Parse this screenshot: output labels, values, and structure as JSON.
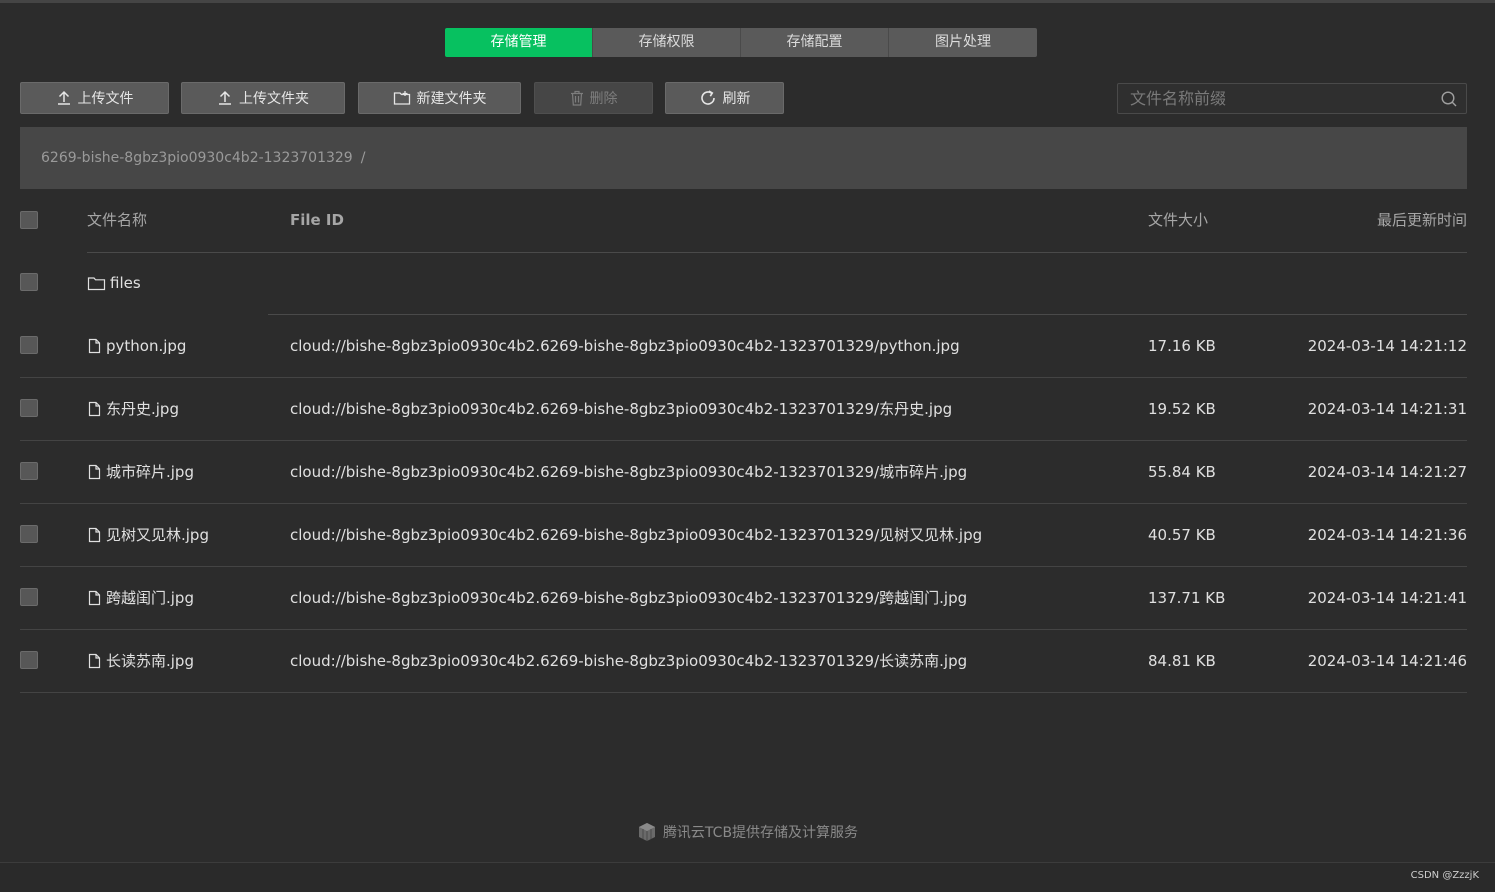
{
  "tabs": [
    {
      "label": "存储管理",
      "active": true
    },
    {
      "label": "存储权限",
      "active": false
    },
    {
      "label": "存储配置",
      "active": false
    },
    {
      "label": "图片处理",
      "active": false
    }
  ],
  "toolbar": {
    "upload_file": "上传文件",
    "upload_folder": "上传文件夹",
    "new_folder": "新建文件夹",
    "delete": "删除",
    "refresh": "刷新"
  },
  "search": {
    "placeholder": "文件名称前缀",
    "value": ""
  },
  "breadcrumb": {
    "bucket": "6269-bishe-8gbz3pio0930c4b2-1323701329",
    "separator": "/"
  },
  "table": {
    "headers": {
      "name": "文件名称",
      "file_id": "File ID",
      "size": "文件大小",
      "updated": "最后更新时间"
    },
    "rows": [
      {
        "type": "folder",
        "name": "files",
        "file_id": "",
        "size": "",
        "updated": ""
      },
      {
        "type": "file",
        "name": "python.jpg",
        "file_id": "cloud://bishe-8gbz3pio0930c4b2.6269-bishe-8gbz3pio0930c4b2-1323701329/python.jpg",
        "size": "17.16 KB",
        "updated": "2024-03-14 14:21:12"
      },
      {
        "type": "file",
        "name": "东丹史.jpg",
        "file_id": "cloud://bishe-8gbz3pio0930c4b2.6269-bishe-8gbz3pio0930c4b2-1323701329/东丹史.jpg",
        "size": "19.52 KB",
        "updated": "2024-03-14 14:21:31"
      },
      {
        "type": "file",
        "name": "城市碎片.jpg",
        "file_id": "cloud://bishe-8gbz3pio0930c4b2.6269-bishe-8gbz3pio0930c4b2-1323701329/城市碎片.jpg",
        "size": "55.84 KB",
        "updated": "2024-03-14 14:21:27"
      },
      {
        "type": "file",
        "name": "见树又见林.jpg",
        "file_id": "cloud://bishe-8gbz3pio0930c4b2.6269-bishe-8gbz3pio0930c4b2-1323701329/见树又见林.jpg",
        "size": "40.57 KB",
        "updated": "2024-03-14 14:21:36"
      },
      {
        "type": "file",
        "name": "跨越闺门.jpg",
        "file_id": "cloud://bishe-8gbz3pio0930c4b2.6269-bishe-8gbz3pio0930c4b2-1323701329/跨越闺门.jpg",
        "size": "137.71 KB",
        "updated": "2024-03-14 14:21:41"
      },
      {
        "type": "file",
        "name": "长读苏南.jpg",
        "file_id": "cloud://bishe-8gbz3pio0930c4b2.6269-bishe-8gbz3pio0930c4b2-1323701329/长读苏南.jpg",
        "size": "84.81 KB",
        "updated": "2024-03-14 14:21:46"
      }
    ]
  },
  "footer": {
    "text": "腾讯云TCB提供存储及计算服务"
  },
  "credit": "CSDN @ZzzjK",
  "colors": {
    "accent": "#07c160",
    "background": "#2c2c2c"
  }
}
